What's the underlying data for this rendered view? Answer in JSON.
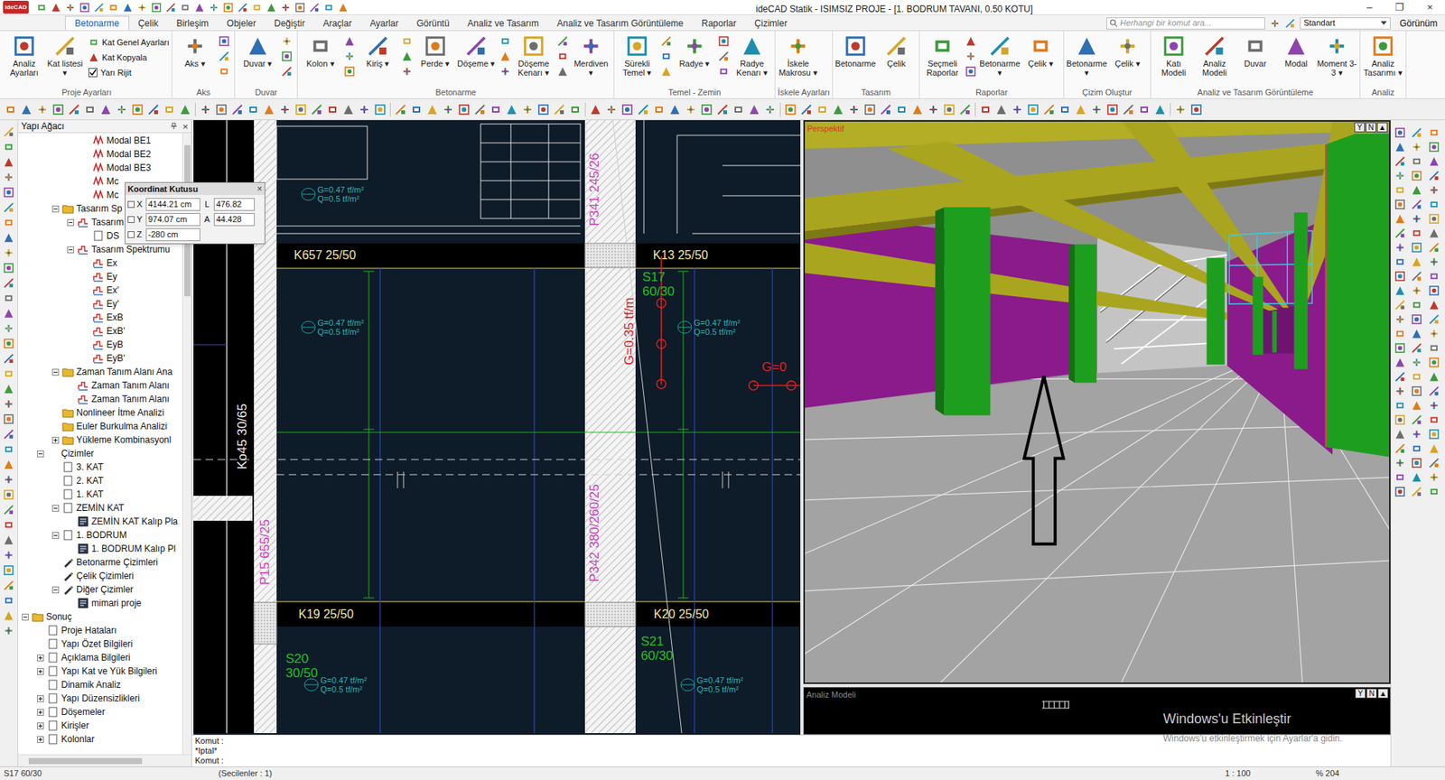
{
  "window": {
    "logo": "ideCAD",
    "title": "ideCAD Statik - ISIMSIZ PROJE - [1. BODRUM TAVANI,  0.50 KOTU]",
    "controls": [
      "–",
      "❐",
      "×"
    ]
  },
  "tabs": [
    {
      "label": "Betonarme",
      "selected": true
    },
    {
      "label": "Çelik",
      "selected": false
    },
    {
      "label": "Birleşim",
      "selected": false
    },
    {
      "label": "Objeler",
      "selected": false
    },
    {
      "label": "Değiştir",
      "selected": false
    },
    {
      "label": "Araçlar",
      "selected": false
    },
    {
      "label": "Ayarlar",
      "selected": false
    },
    {
      "label": "Görüntü",
      "selected": false
    },
    {
      "label": "Analiz ve Tasarım",
      "selected": false
    },
    {
      "label": "Analiz ve Tasarım Görüntüleme",
      "selected": false
    },
    {
      "label": "Raporlar",
      "selected": false
    },
    {
      "label": "Çizimler",
      "selected": false
    }
  ],
  "search": {
    "placeholder": "Herhangi bir komut ara..."
  },
  "style_select": "Standart",
  "view_menu": "Görünüm",
  "ribbon": [
    {
      "label": "Proje Ayarları",
      "large": [
        "Analiz Ayarları",
        "Kat listesi ▾"
      ],
      "small": [
        {
          "label": "Kat Genel Ayarları",
          "kind": "button"
        },
        {
          "label": "Kat Kopyala",
          "kind": "button"
        },
        {
          "label": "Yarı Rijit",
          "kind": "checkbox",
          "checked": true
        }
      ]
    },
    {
      "label": "Aks",
      "large": [
        "Aks ▾"
      ],
      "small": []
    },
    {
      "label": "Duvar",
      "large": [
        "Duvar ▾"
      ],
      "small": []
    },
    {
      "label": "Betonarme",
      "large": [
        "Kolon ▾",
        "Kiriş ▾",
        "Perde ▾",
        "Döşeme ▾",
        "Döşeme Kenarı ▾",
        "Merdiven ▾"
      ],
      "small": []
    },
    {
      "label": "Temel - Zemin",
      "large": [
        "Sürekli Temel ▾",
        "Radye ▾",
        "Radye Kenarı ▾"
      ],
      "small": []
    },
    {
      "label": "İskele Ayarları",
      "large": [
        "İskele Makrosu ▾"
      ],
      "small": []
    },
    {
      "label": "Tasarım",
      "large": [
        "Betonarme",
        "Çelik"
      ],
      "small": []
    },
    {
      "label": "Raporlar",
      "large": [
        "Seçmeli Raporlar",
        "Betonarme ▾",
        "Çelik ▾"
      ],
      "small": []
    },
    {
      "label": "Çizim Oluştur",
      "large": [
        "Betonarme ▾",
        "Çelik ▾"
      ],
      "small": []
    },
    {
      "label": "Analiz ve Tasarım Görüntüleme",
      "large": [
        "Katı Modeli",
        "Analiz Modeli",
        "Duvar",
        "Modal",
        "Moment 3-3 ▾"
      ],
      "small": []
    },
    {
      "label": "Analiz",
      "large": [
        "Analiz Tasarımı ▾"
      ],
      "small": []
    }
  ],
  "tree": {
    "title": "Yapı Ağacı",
    "close": "×",
    "items": [
      {
        "label": "Modal BE1",
        "depth": 4,
        "kind": "modal",
        "expandable": false,
        "expanded": false
      },
      {
        "label": "Modal BE2",
        "depth": 4,
        "kind": "modal",
        "expandable": false,
        "expanded": false
      },
      {
        "label": "Modal BE3",
        "depth": 4,
        "kind": "modal",
        "expandable": false,
        "expanded": false
      },
      {
        "label": "Mc",
        "depth": 4,
        "kind": "modal",
        "expandable": false,
        "expanded": false
      },
      {
        "label": "Mc",
        "depth": 4,
        "kind": "modal",
        "expandable": false,
        "expanded": false
      },
      {
        "label": "Tasarım Sp",
        "depth": 2,
        "kind": "folder",
        "expandable": true,
        "expanded": true
      },
      {
        "label": "Tasarım",
        "depth": 3,
        "kind": "spectrum",
        "expandable": true,
        "expanded": true
      },
      {
        "label": "DS",
        "depth": 4,
        "kind": "doc",
        "expandable": false,
        "expanded": false
      },
      {
        "label": "Tasarım Spektrumu",
        "depth": 3,
        "kind": "spectrum",
        "expandable": true,
        "expanded": true
      },
      {
        "label": "Ex",
        "depth": 4,
        "kind": "spectrum",
        "expandable": false,
        "expanded": false
      },
      {
        "label": "Ey",
        "depth": 4,
        "kind": "spectrum",
        "expandable": false,
        "expanded": false
      },
      {
        "label": "Ex'",
        "depth": 4,
        "kind": "spectrum",
        "expandable": false,
        "expanded": false
      },
      {
        "label": "Ey'",
        "depth": 4,
        "kind": "spectrum",
        "expandable": false,
        "expanded": false
      },
      {
        "label": "ExB",
        "depth": 4,
        "kind": "spectrum",
        "expandable": false,
        "expanded": false
      },
      {
        "label": "ExB'",
        "depth": 4,
        "kind": "spectrum",
        "expandable": false,
        "expanded": false
      },
      {
        "label": "EyB",
        "depth": 4,
        "kind": "spectrum",
        "expandable": false,
        "expanded": false
      },
      {
        "label": "EyB'",
        "depth": 4,
        "kind": "spectrum",
        "expandable": false,
        "expanded": false
      },
      {
        "label": "Zaman Tanım Alanı Ana",
        "depth": 2,
        "kind": "folder",
        "expandable": true,
        "expanded": true
      },
      {
        "label": "Zaman Tanım Alanı",
        "depth": 3,
        "kind": "spectrum",
        "expandable": false,
        "expanded": false
      },
      {
        "label": "Zaman Tanım Alanı",
        "depth": 3,
        "kind": "spectrum",
        "expandable": false,
        "expanded": false
      },
      {
        "label": "Nonlineer İtme Analizi",
        "depth": 2,
        "kind": "folder",
        "expandable": false,
        "expanded": false
      },
      {
        "label": "Euler Burkulma Analizi",
        "depth": 2,
        "kind": "folder",
        "expandable": false,
        "expanded": false
      },
      {
        "label": "Yükleme Kombinasyonl",
        "depth": 2,
        "kind": "folder",
        "expandable": true,
        "expanded": false
      },
      {
        "label": "Çizimler",
        "depth": 1,
        "kind": "none",
        "expandable": true,
        "expanded": true
      },
      {
        "label": "3. KAT",
        "depth": 2,
        "kind": "doc",
        "expandable": false,
        "expanded": false
      },
      {
        "label": "2. KAT",
        "depth": 2,
        "kind": "doc",
        "expandable": false,
        "expanded": false
      },
      {
        "label": "1. KAT",
        "depth": 2,
        "kind": "doc",
        "expandable": false,
        "expanded": false
      },
      {
        "label": "ZEMİN KAT",
        "depth": 2,
        "kind": "doc",
        "expandable": true,
        "expanded": true
      },
      {
        "label": "ZEMİN KAT Kalıp Pla",
        "depth": 3,
        "kind": "drawing",
        "expandable": false,
        "expanded": false
      },
      {
        "label": "1. BODRUM",
        "depth": 2,
        "kind": "doc",
        "expandable": true,
        "expanded": true
      },
      {
        "label": "1. BODRUM Kalıp Pl",
        "depth": 3,
        "kind": "drawing",
        "expandable": false,
        "expanded": false
      },
      {
        "label": "Betonarme Çizimleri",
        "depth": 2,
        "kind": "pen",
        "expandable": false,
        "expanded": false
      },
      {
        "label": "Çelik Çizimleri",
        "depth": 2,
        "kind": "pen",
        "expandable": false,
        "expanded": false
      },
      {
        "label": "Diğer Çizimler",
        "depth": 2,
        "kind": "pen",
        "expandable": true,
        "expanded": true
      },
      {
        "label": "mimari proje",
        "depth": 3,
        "kind": "drawing",
        "expandable": false,
        "expanded": false
      },
      {
        "label": "Sonuç",
        "depth": 0,
        "kind": "folder",
        "expandable": true,
        "expanded": true
      },
      {
        "label": "Proje Hataları",
        "depth": 1,
        "kind": "doc",
        "expandable": false,
        "expanded": false
      },
      {
        "label": "Yapı Özet Bilgileri",
        "depth": 1,
        "kind": "doc",
        "expandable": false,
        "expanded": false
      },
      {
        "label": "Açıklama Bilgileri",
        "depth": 1,
        "kind": "doc",
        "expandable": true,
        "expanded": false
      },
      {
        "label": "Yapı Kat ve Yük Bilgileri",
        "depth": 1,
        "kind": "doc",
        "expandable": true,
        "expanded": false
      },
      {
        "label": "Dinamik Analiz",
        "depth": 1,
        "kind": "doc",
        "expandable": false,
        "expanded": false
      },
      {
        "label": "Yapı Düzensizlikleri",
        "depth": 1,
        "kind": "doc",
        "expandable": true,
        "expanded": false
      },
      {
        "label": "Döşemeler",
        "depth": 1,
        "kind": "doc",
        "expandable": true,
        "expanded": false
      },
      {
        "label": "Kirişler",
        "depth": 1,
        "kind": "doc",
        "expandable": true,
        "expanded": false
      },
      {
        "label": "Kolonlar",
        "depth": 1,
        "kind": "doc",
        "expandable": true,
        "expanded": false
      }
    ]
  },
  "coordinate_box": {
    "title": "Koordinat Kutusu",
    "close": "×",
    "rows": [
      {
        "axis": "X",
        "value": "4144.21 cm",
        "label2": "L",
        "value2": "476.82 cm"
      },
      {
        "axis": "Y",
        "value": "974.07 cm",
        "label2": "A",
        "value2": "44.428"
      },
      {
        "axis": "Z",
        "value": "-280 cm",
        "label2": "",
        "value2": ""
      }
    ]
  },
  "drawing": {
    "beams": [
      "K657 25/50",
      "K13 25/50",
      "K19 25/50",
      "K20 25/50"
    ],
    "columns": [
      "Ko45 30/65",
      "P15 655/25",
      "P342 380/260/25",
      "P341 245/26"
    ],
    "slabs": [
      {
        "name": "S17",
        "size": "60/30"
      },
      {
        "name": "S20",
        "size": "30/50"
      },
      {
        "name": "S21",
        "size": "60/30"
      }
    ],
    "loads": [
      {
        "g": "G=0.47 tf/m²",
        "q": "Q=0.5 tf/m²"
      },
      {
        "g": "G=0.47 tf/m²",
        "q": "Q=0.5 tf/m²"
      },
      {
        "g": "G=0.47 tf/m²",
        "q": "Q=0.5 tf/m²"
      },
      {
        "g": "G=0.47 tf/m²",
        "q": "Q=0.5 tf/m²"
      },
      {
        "g": "G=0.47 tf/m²",
        "q": "Q=0.5 tf/m²"
      }
    ],
    "red_labels": [
      "G=0.35 tf/m",
      "G=0"
    ]
  },
  "view3d": {
    "label": "Perspektif",
    "buttons": [
      "Y",
      "N",
      "▲"
    ]
  },
  "analysis_view": {
    "label": "Analiz Modeli",
    "buttons": [
      "Y",
      "N",
      "▲"
    ]
  },
  "command": {
    "lines": [
      "Komut :",
      "*Iptal*",
      "Komut :"
    ]
  },
  "status_bar": [
    "S17 60/30",
    "(Secilenler : 1)",
    "1 : 100",
    "% 204"
  ],
  "watermark": {
    "title": "Windows'u Etkinleştir",
    "subtitle": "Windows'u etkinleştirmek için Ayarlar'a gidin."
  }
}
